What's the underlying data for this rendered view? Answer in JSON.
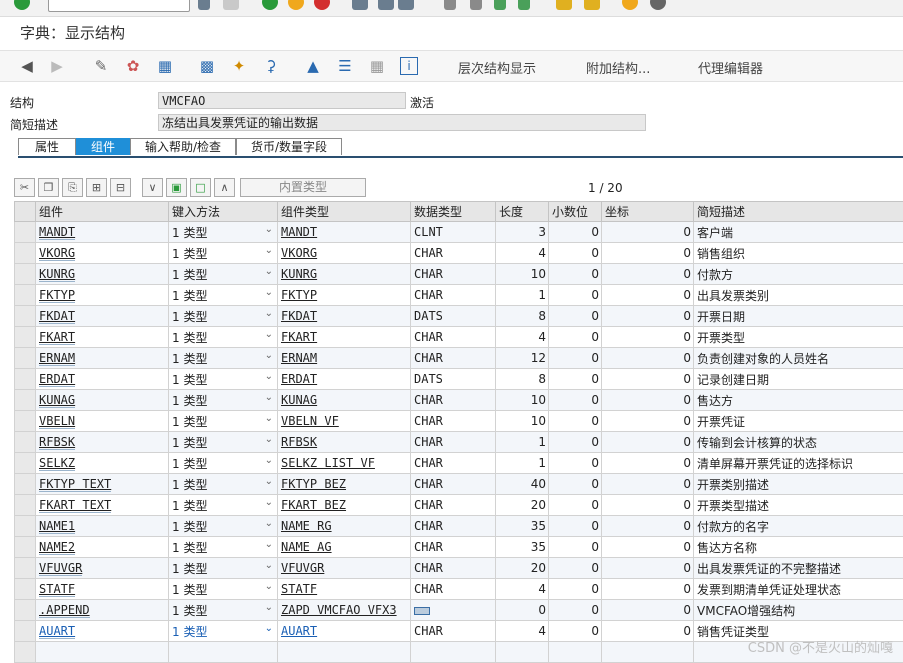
{
  "title": "字典：显示结构",
  "toolbar": {
    "hierarchy_label": "层次结构显示",
    "append_label": "附加结构...",
    "proxy_label": "代理编辑器"
  },
  "header": {
    "structure_label": "结构",
    "structure_value": "VMCFAO",
    "status": "激活",
    "desc_label": "简短描述",
    "desc_value": "冻结出具发票凭证的输出数据"
  },
  "tabs": [
    "属性",
    "组件",
    "输入帮助/检查",
    "货币/数量字段"
  ],
  "table_toolbar": {
    "inner_type_label": "内置类型",
    "pager": "1  /  20"
  },
  "columns": [
    "组件",
    "键入方法",
    "组件类型",
    "数据类型",
    "长度",
    "小数位",
    "坐标",
    "简短描述"
  ],
  "rows": [
    {
      "comp": "MANDT",
      "method": "1 类型",
      "ctype": "MANDT",
      "dtype": "CLNT",
      "len": "3",
      "dec": "0",
      "coord": "0",
      "desc": "客户端"
    },
    {
      "comp": "VKORG",
      "method": "1 类型",
      "ctype": "VKORG",
      "dtype": "CHAR",
      "len": "4",
      "dec": "0",
      "coord": "0",
      "desc": "销售组织"
    },
    {
      "comp": "KUNRG",
      "method": "1 类型",
      "ctype": "KUNRG",
      "dtype": "CHAR",
      "len": "10",
      "dec": "0",
      "coord": "0",
      "desc": "付款方"
    },
    {
      "comp": "FKTYP",
      "method": "1 类型",
      "ctype": "FKTYP",
      "dtype": "CHAR",
      "len": "1",
      "dec": "0",
      "coord": "0",
      "desc": "出具发票类别"
    },
    {
      "comp": "FKDAT",
      "method": "1 类型",
      "ctype": "FKDAT",
      "dtype": "DATS",
      "len": "8",
      "dec": "0",
      "coord": "0",
      "desc": "开票日期"
    },
    {
      "comp": "FKART",
      "method": "1 类型",
      "ctype": "FKART",
      "dtype": "CHAR",
      "len": "4",
      "dec": "0",
      "coord": "0",
      "desc": "开票类型"
    },
    {
      "comp": "ERNAM",
      "method": "1 类型",
      "ctype": "ERNAM",
      "dtype": "CHAR",
      "len": "12",
      "dec": "0",
      "coord": "0",
      "desc": "负责创建对象的人员姓名"
    },
    {
      "comp": "ERDAT",
      "method": "1 类型",
      "ctype": "ERDAT",
      "dtype": "DATS",
      "len": "8",
      "dec": "0",
      "coord": "0",
      "desc": "记录创建日期"
    },
    {
      "comp": "KUNAG",
      "method": "1 类型",
      "ctype": "KUNAG",
      "dtype": "CHAR",
      "len": "10",
      "dec": "0",
      "coord": "0",
      "desc": "售达方"
    },
    {
      "comp": "VBELN",
      "method": "1 类型",
      "ctype": "VBELN VF",
      "dtype": "CHAR",
      "len": "10",
      "dec": "0",
      "coord": "0",
      "desc": "开票凭证"
    },
    {
      "comp": "RFBSK",
      "method": "1 类型",
      "ctype": "RFBSK",
      "dtype": "CHAR",
      "len": "1",
      "dec": "0",
      "coord": "0",
      "desc": "传输到会计核算的状态"
    },
    {
      "comp": "SELKZ",
      "method": "1 类型",
      "ctype": "SELKZ LIST VF",
      "dtype": "CHAR",
      "len": "1",
      "dec": "0",
      "coord": "0",
      "desc": "清单屏幕开票凭证的选择标识"
    },
    {
      "comp": "FKTYP TEXT",
      "method": "1 类型",
      "ctype": "FKTYP BEZ",
      "dtype": "CHAR",
      "len": "40",
      "dec": "0",
      "coord": "0",
      "desc": "开票类别描述"
    },
    {
      "comp": "FKART TEXT",
      "method": "1 类型",
      "ctype": "FKART BEZ",
      "dtype": "CHAR",
      "len": "20",
      "dec": "0",
      "coord": "0",
      "desc": "开票类型描述"
    },
    {
      "comp": "NAME1",
      "method": "1 类型",
      "ctype": "NAME RG",
      "dtype": "CHAR",
      "len": "35",
      "dec": "0",
      "coord": "0",
      "desc": "付款方的名字"
    },
    {
      "comp": "NAME2",
      "method": "1 类型",
      "ctype": "NAME AG",
      "dtype": "CHAR",
      "len": "35",
      "dec": "0",
      "coord": "0",
      "desc": "售达方名称"
    },
    {
      "comp": "VFUVGR",
      "method": "1 类型",
      "ctype": "VFUVGR",
      "dtype": "CHAR",
      "len": "20",
      "dec": "0",
      "coord": "0",
      "desc": "出具发票凭证的不完整描述"
    },
    {
      "comp": "STATF",
      "method": "1 类型",
      "ctype": "STATF",
      "dtype": "CHAR",
      "len": "4",
      "dec": "0",
      "coord": "0",
      "desc": "发票到期清单凭证处理状态"
    },
    {
      "comp": ".APPEND",
      "method": "1 类型",
      "ctype": "ZAPD VMCFAO VFX3",
      "dtype": "",
      "len": "0",
      "dec": "0",
      "coord": "0",
      "desc": "VMCFAO增强结构"
    },
    {
      "comp": "AUART",
      "method": "1 类型",
      "ctype": "AUART",
      "dtype": "CHAR",
      "len": "4",
      "dec": "0",
      "coord": "0",
      "desc": "销售凭证类型"
    }
  ],
  "watermark": "CSDN @不是火山的灿嘎",
  "colors": {
    "active_tab": "#1f8fd8",
    "accent_dark": "#2a4f70",
    "link_blue": "#1a5fb4"
  }
}
